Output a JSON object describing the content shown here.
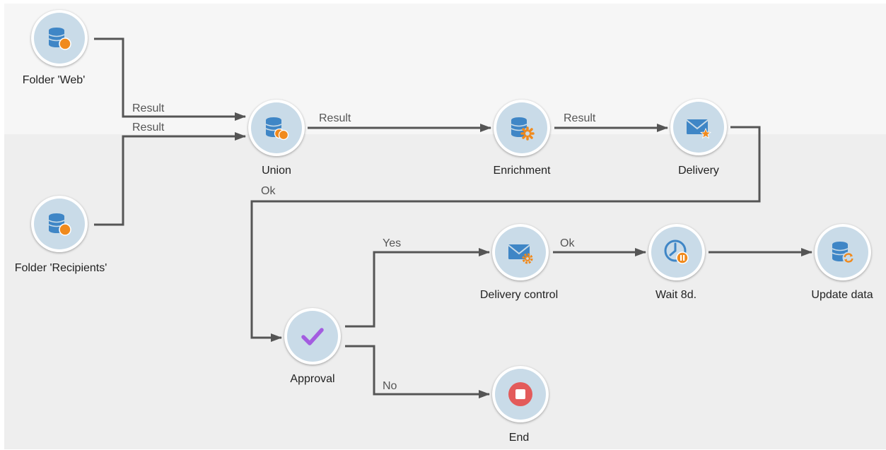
{
  "nodes": {
    "folder_web": {
      "label": "Folder 'Web'",
      "icon": "database-orange-dot-icon"
    },
    "folder_recipients": {
      "label": "Folder 'Recipients'",
      "icon": "database-orange-dot-icon"
    },
    "union": {
      "label": "Union",
      "icon": "database-union-icon"
    },
    "enrichment": {
      "label": "Enrichment",
      "icon": "database-enrichment-icon"
    },
    "delivery": {
      "label": "Delivery",
      "icon": "mail-star-icon"
    },
    "approval": {
      "label": "Approval",
      "icon": "checkmark-icon"
    },
    "delivery_control": {
      "label": "Delivery control",
      "icon": "mail-gear-icon"
    },
    "wait": {
      "label": "Wait 8d.",
      "icon": "clock-pause-icon"
    },
    "update_data": {
      "label": "Update data",
      "icon": "database-refresh-icon"
    },
    "end": {
      "label": "End",
      "icon": "stop-icon"
    }
  },
  "links": {
    "web_to_union": "Result",
    "recipients_to_union": "Result",
    "union_to_enrichment": "Result",
    "enrichment_to_delivery": "Result",
    "delivery_to_approval": "Ok",
    "approval_yes": "Yes",
    "approval_no": "No",
    "control_to_wait": "Ok"
  },
  "colors": {
    "node_fill": "#c9dbe8",
    "icon_blue": "#3f86c6",
    "accent_orange": "#f08a1d",
    "approval_purple": "#a35ce0",
    "stop_red": "#e35b5b",
    "connector": "#555555"
  }
}
